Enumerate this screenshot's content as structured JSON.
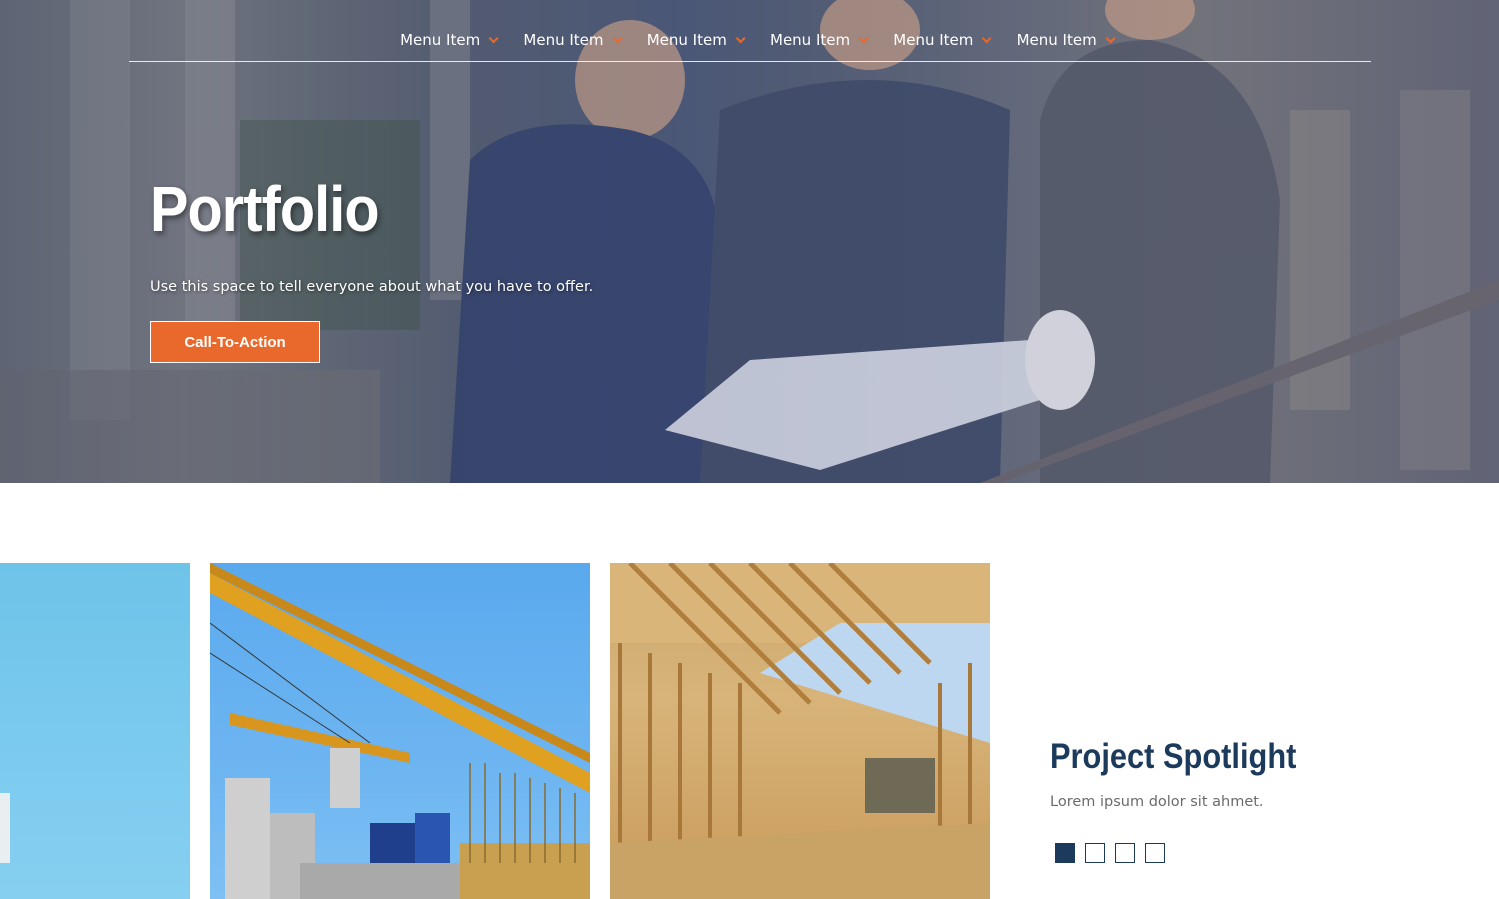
{
  "nav": {
    "items": [
      {
        "label": "Menu Item"
      },
      {
        "label": "Menu Item"
      },
      {
        "label": "Menu Item"
      },
      {
        "label": "Menu Item"
      },
      {
        "label": "Menu Item"
      },
      {
        "label": "Menu Item"
      }
    ]
  },
  "hero": {
    "title": "Portfolio",
    "subtitle": "Use this space to tell everyone about what you have to offer.",
    "cta_label": "Call-To-Action"
  },
  "spotlight": {
    "title": "Project Spotlight",
    "text": "Lorem ipsum dolor sit ahmet.",
    "pages": 4,
    "active_page": 1
  },
  "colors": {
    "accent": "#e8692b",
    "navy": "#1c3a5c"
  }
}
